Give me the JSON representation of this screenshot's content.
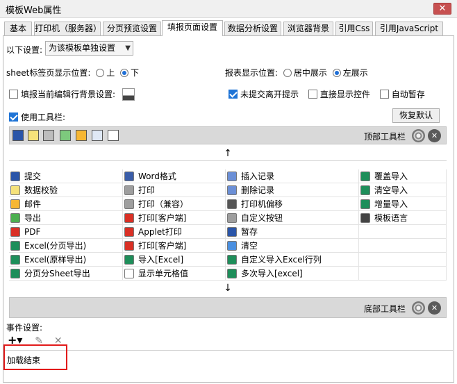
{
  "window": {
    "title": "模板Web属性",
    "close_glyph": "✕"
  },
  "tabs": [
    {
      "label": "基本"
    },
    {
      "label": "打印机（服务器）"
    },
    {
      "label": "分页预览设置"
    },
    {
      "label": "填报页面设置"
    },
    {
      "label": "数据分析设置"
    },
    {
      "label": "浏览器背景"
    },
    {
      "label": "引用Css"
    },
    {
      "label": "引用JavaScript"
    }
  ],
  "settings": {
    "scope_label": "以下设置:",
    "scope_value": "为该模板单独设置",
    "sheet_pos_label": "sheet标签页显示位置:",
    "sheet_top": "上",
    "sheet_bottom": "下",
    "report_pos_label": "报表显示位置:",
    "report_center": "居中展示",
    "report_left": "左展示",
    "highlight_bg_label": "填报当前编辑行背景设置:",
    "unsubmitted_label": "未提交离开提示",
    "direct_ctrl_label": "直接显示控件",
    "autosave_label": "自动暂存",
    "use_toolbar_label": "使用工具栏:",
    "restore_label": "恢复默认"
  },
  "top_toolbar": {
    "label": "顶部工具栏"
  },
  "bottom_toolbar": {
    "label": "底部工具栏"
  },
  "arrows": {
    "up": "↑",
    "down": "↓"
  },
  "items": {
    "col1": [
      "提交",
      "数据校验",
      "邮件",
      "导出",
      "PDF",
      "Excel(分页导出)",
      "Excel(原样导出)",
      "分页分Sheet导出"
    ],
    "col2": [
      "Word格式",
      "打印",
      "打印（兼容）",
      "打印[客户端]",
      "Applet打印",
      "打印[客户端]",
      "导入[Excel]",
      "显示单元格值"
    ],
    "col3": [
      "插入记录",
      "删除记录",
      "打印机偏移",
      "自定义按钮",
      "暂存",
      "清空",
      "自定义导入Excel行列",
      "多次导入[excel]"
    ],
    "col4": [
      "覆盖导入",
      "清空导入",
      "增量导入",
      "模板语言",
      "",
      "",
      "",
      ""
    ]
  },
  "events": {
    "label": "事件设置:",
    "add_glyph": "+▾",
    "edit_glyph": "✎",
    "delete_glyph": "✕",
    "entries": [
      "加载结束"
    ]
  },
  "colors": {
    "highlight": "#e21a1a",
    "accent": "#1f74d6",
    "toolbar": "#d9d9d9"
  }
}
